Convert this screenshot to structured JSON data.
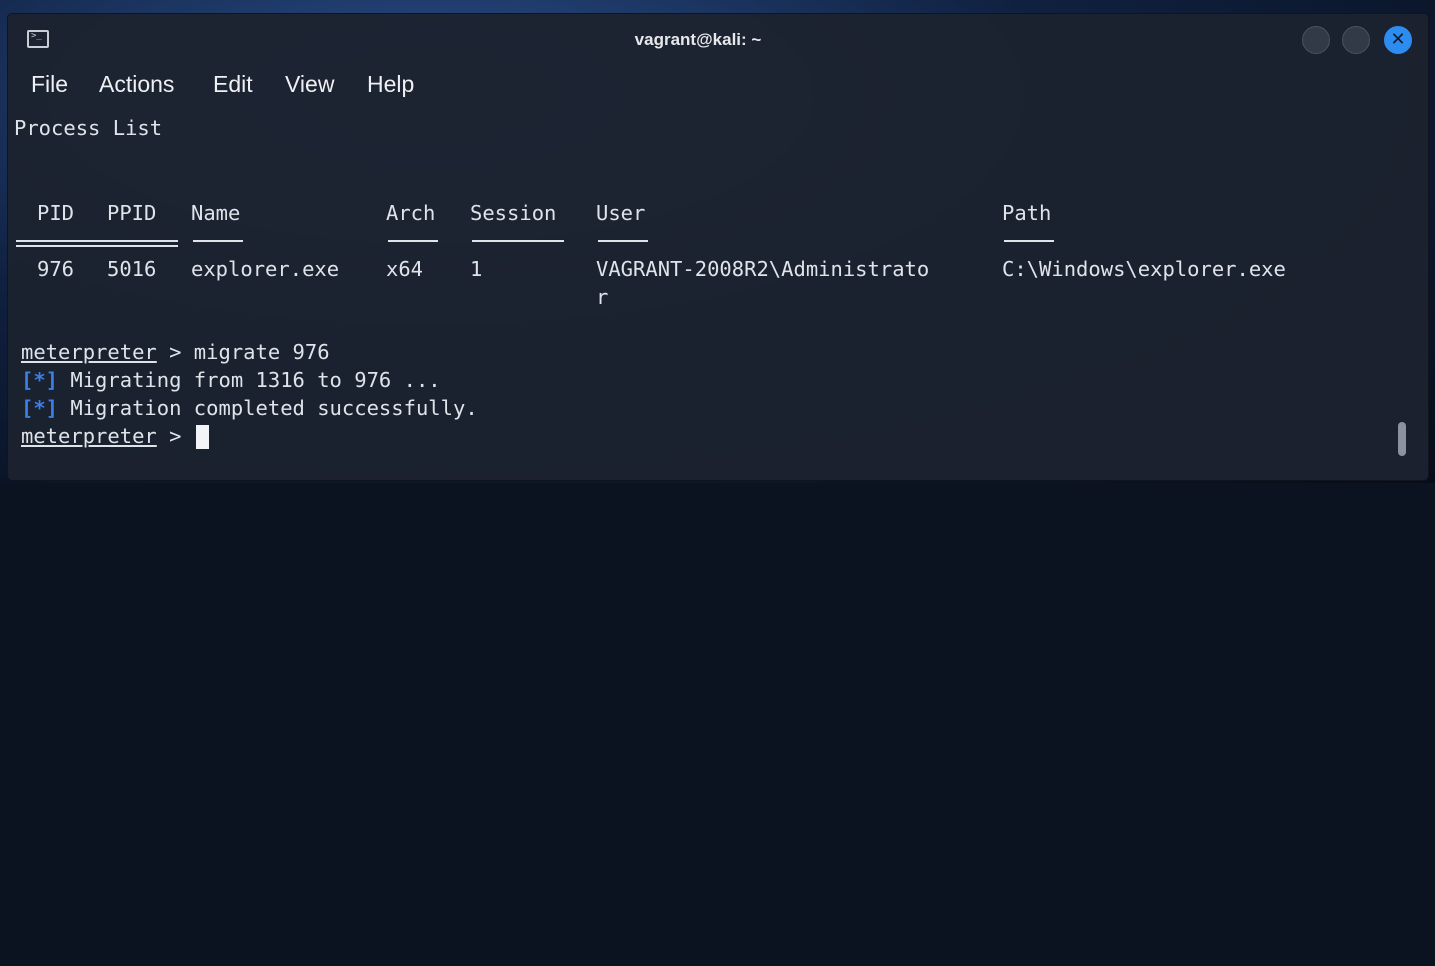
{
  "window": {
    "title": "vagrant@kali: ~",
    "icon": "terminal-icon",
    "buttons": {
      "minimize": "minimize-icon",
      "maximize": "maximize-icon",
      "close_glyph": "✕"
    }
  },
  "menubar": {
    "items": [
      "File",
      "Actions",
      "Edit",
      "View",
      "Help"
    ]
  },
  "terminal": {
    "section_title": "Process List",
    "table": {
      "headers": [
        "PID",
        "PPID",
        "Name",
        "Arch",
        "Session",
        "User",
        "Path"
      ],
      "rows": [
        {
          "pid": "976",
          "ppid": "5016",
          "name": "explorer.exe",
          "arch": "x64",
          "session": "1",
          "user_line1": "VAGRANT-2008R2\\Administrato",
          "user_line2": "r",
          "path": "C:\\Windows\\explorer.exe"
        }
      ]
    },
    "lines": [
      {
        "prompt": "meterpreter",
        "text": " > migrate 976"
      },
      {
        "tag": "[*]",
        "text": " Migrating from 1316 to 976 ..."
      },
      {
        "tag": "[*]",
        "text": " Migration completed successfully."
      },
      {
        "prompt": "meterpreter",
        "text": " > "
      }
    ]
  },
  "colors": {
    "accent": "#2d8cf0",
    "info_tag": "#3b7fe8",
    "text": "#dfe3ea",
    "background": "#1c222f"
  }
}
